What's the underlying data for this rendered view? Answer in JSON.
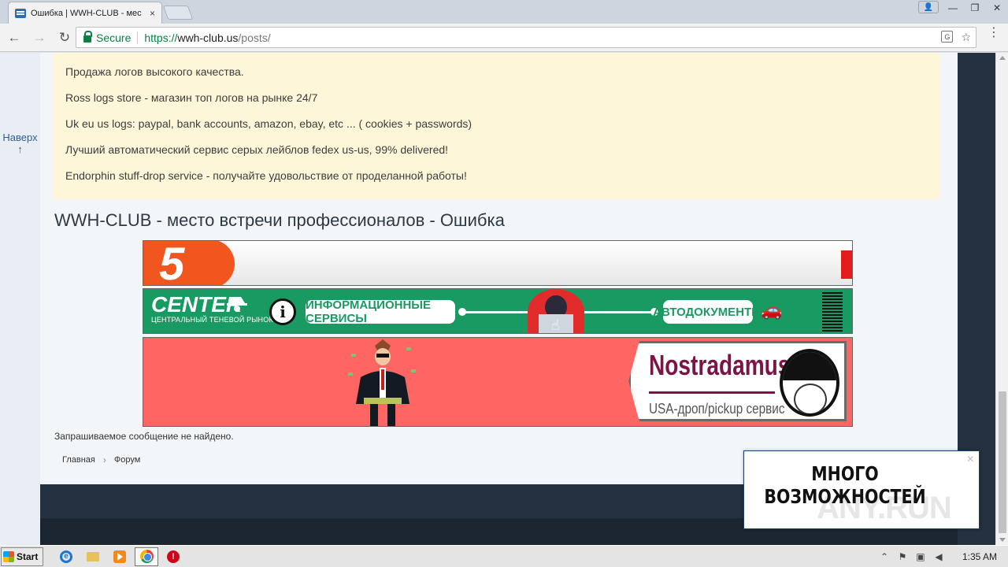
{
  "browser": {
    "tab_title": "Ошибка | WWH-CLUB - мес",
    "tab_close": "×",
    "window_controls": {
      "user": "👤",
      "minimize": "—",
      "maximize": "❐",
      "close": "✕"
    },
    "omnibox": {
      "secure_label": "Secure",
      "url_scheme": "https://",
      "url_host": "wwh-club.us",
      "url_path": "/posts/"
    },
    "nav": {
      "back": "←",
      "forward": "→",
      "reload": "↻"
    },
    "star": "☆",
    "menu": "⋮"
  },
  "sidebar": {
    "to_top_label": "Наверх",
    "to_top_arrow": "↑"
  },
  "notice": {
    "lines": [
      "Продажа логов высокого качества.",
      "Ross logs store - магазин топ логов на рынке 24/7",
      "Uk eu us logs: paypal, bank accounts, amazon, ebay, etc ... ( cookies + passwords)",
      "Лучший автоматический сервис серых лейблов fedex us-us, 99% delivered!",
      "Endorphin stuff-drop service - получайте удовольствие от проделанной работы!"
    ]
  },
  "page": {
    "title": "WWH-CLUB - место встречи профессионалов - Ошибка",
    "not_found": "Запрашиваемое сообщение не найдено.",
    "breadcrumb": {
      "home": "Главная",
      "separator": "›",
      "forum": "Форум"
    }
  },
  "banners": {
    "banner1": {
      "digit": "5"
    },
    "banner2": {
      "logo": "CENTER",
      "logo_sub": "ЦЕНТРАЛЬНЫЙ ТЕНЕВОЙ РЫНОК",
      "info": "i",
      "pill_one": "ИНФОРМАЦИОННЫЕ СЕРВИСЫ",
      "pill_two": "АВТОДОКУМЕНТЫ"
    },
    "banner3": {
      "title": "Nostradamus",
      "subtitle": "USA-дроп/pickup сервис"
    }
  },
  "popup": {
    "line1": "МНОГО",
    "line2": "ВОЗМОЖНОСТЕЙ",
    "close": "×",
    "watermark": "ANY.RUN"
  },
  "taskbar": {
    "start": "Start",
    "time": "1:35 AM"
  },
  "colors": {
    "notice_bg": "#fdf6d8",
    "footer": "#233140",
    "banner2_green": "#1a9a63",
    "banner3_red": "#fd6662",
    "nostradamus": "#7a1545",
    "secure_green": "#0b8043"
  }
}
